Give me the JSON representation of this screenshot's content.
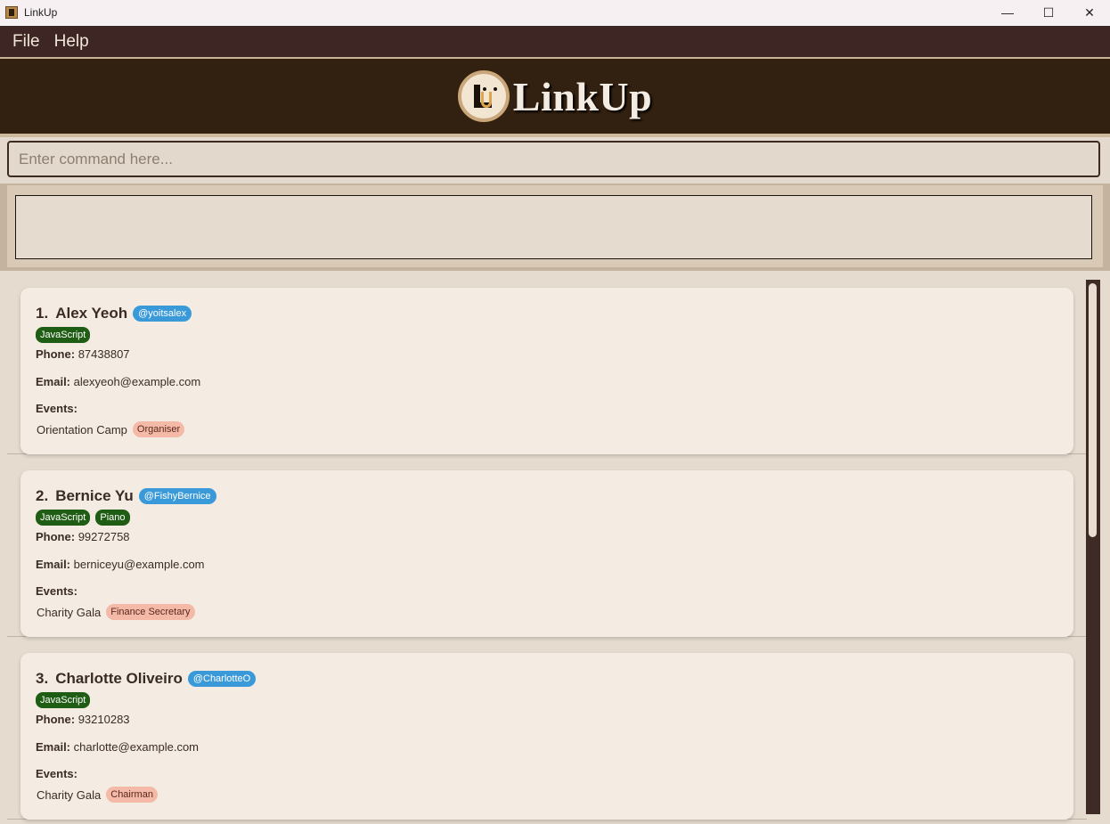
{
  "window": {
    "title": "LinkUp",
    "controls": {
      "minimize": "—",
      "maximize": "☐",
      "close": "✕"
    }
  },
  "menu": {
    "file": "File",
    "help": "Help"
  },
  "header": {
    "brand": "LinkUp",
    "logo_icon": "linkup-logo-icon"
  },
  "command": {
    "placeholder": "Enter command here...",
    "value": ""
  },
  "result": {
    "text": ""
  },
  "persons": [
    {
      "index": "1.",
      "name": "Alex Yeoh",
      "handle": "@yoitsalex",
      "tags": [
        "JavaScript"
      ],
      "phone_label": "Phone:",
      "phone": "87438807",
      "email_label": "Email:",
      "email": "alexyeoh@example.com",
      "events_label": "Events:",
      "event": "Orientation Camp",
      "role": "Organiser"
    },
    {
      "index": "2.",
      "name": "Bernice Yu",
      "handle": "@FishyBernice",
      "tags": [
        "JavaScript",
        "Piano"
      ],
      "phone_label": "Phone:",
      "phone": "99272758",
      "email_label": "Email:",
      "email": "berniceyu@example.com",
      "events_label": "Events:",
      "event": "Charity Gala",
      "role": "Finance Secretary"
    },
    {
      "index": "3.",
      "name": "Charlotte Oliveiro",
      "handle": "@CharlotteO",
      "tags": [
        "JavaScript"
      ],
      "phone_label": "Phone:",
      "phone": "93210283",
      "email_label": "Email:",
      "email": "charlotte@example.com",
      "events_label": "Events:",
      "event": "Charity Gala",
      "role": "Chairman"
    }
  ],
  "colors": {
    "menubar": "#3d2623",
    "header": "#322010",
    "handle_badge": "#3a9ad9",
    "tag": "#1f5c14",
    "role_badge": "#f4b9a7"
  }
}
